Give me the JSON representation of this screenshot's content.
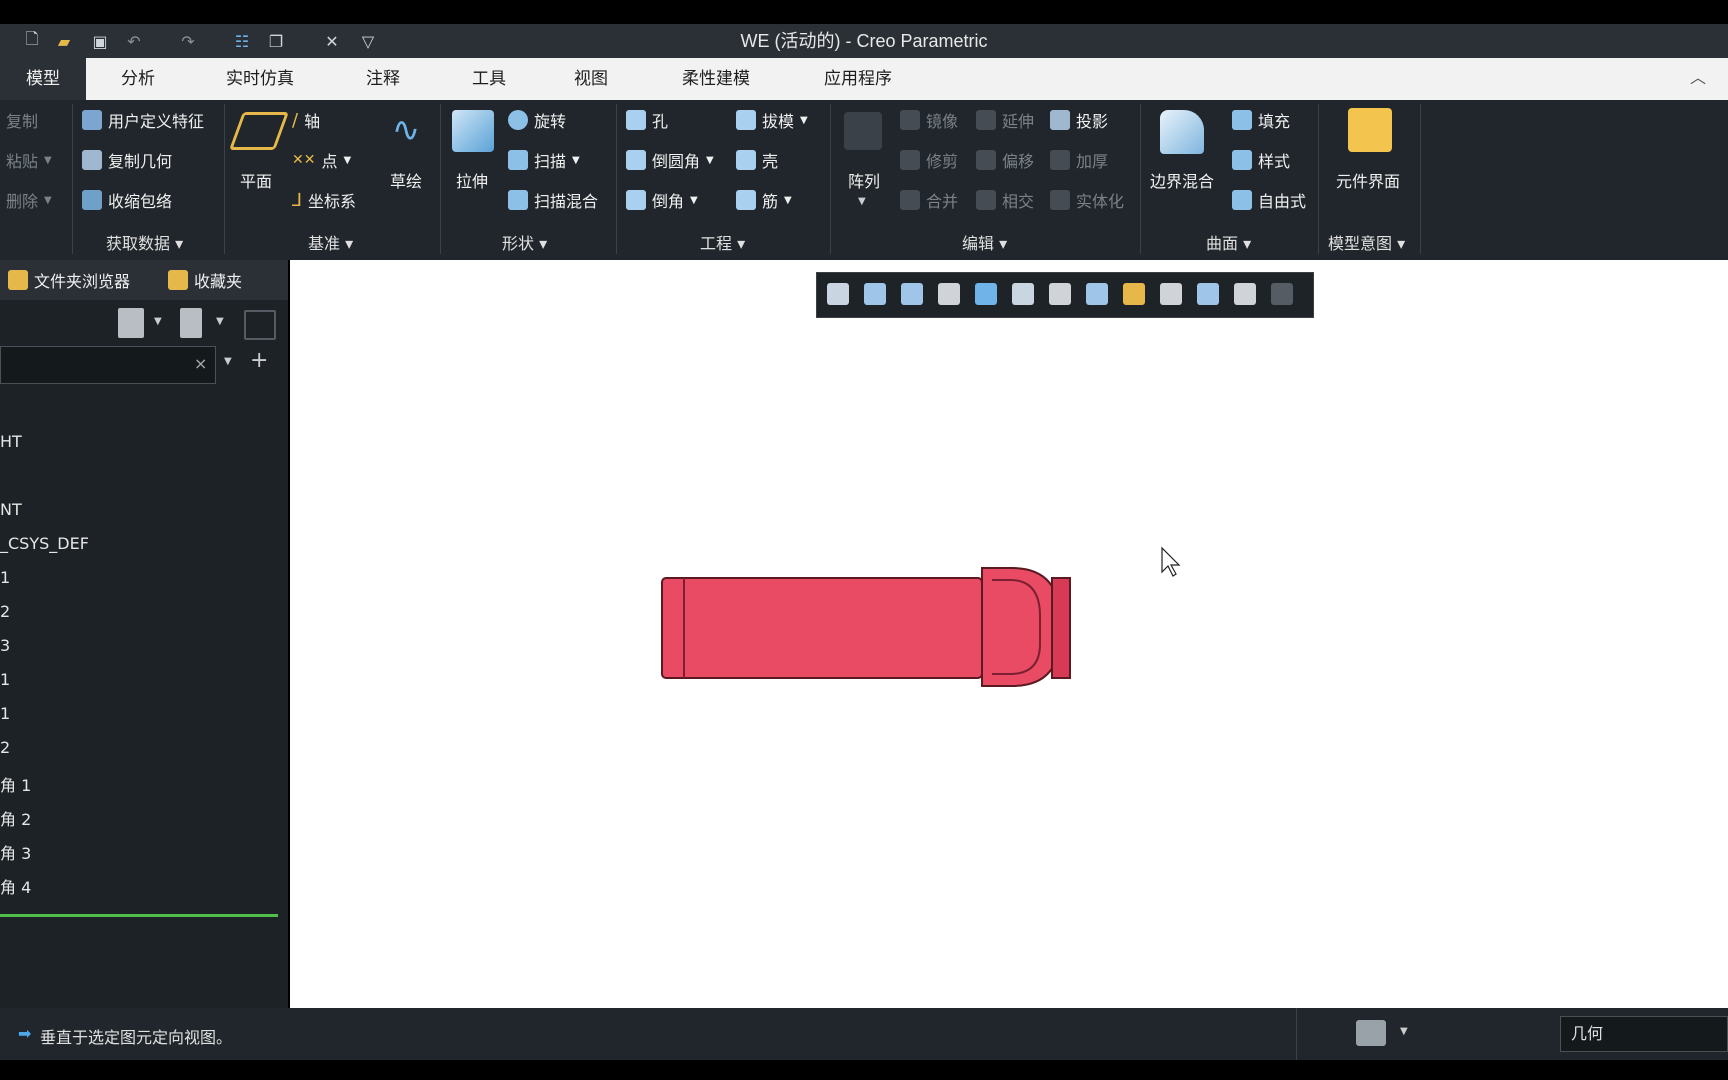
{
  "window": {
    "title": "WE (活动的) - Creo Parametric"
  },
  "quick_access": {
    "icons": [
      "new-icon",
      "open-icon",
      "save-icon",
      "undo-icon",
      "redo-icon",
      "regenerate-icon",
      "windows-icon",
      "close-icon",
      "customize-icon"
    ]
  },
  "tabs": [
    {
      "label": "模型",
      "active": true
    },
    {
      "label": "分析",
      "active": false
    },
    {
      "label": "实时仿真",
      "active": false
    },
    {
      "label": "注释",
      "active": false
    },
    {
      "label": "工具",
      "active": false
    },
    {
      "label": "视图",
      "active": false
    },
    {
      "label": "柔性建模",
      "active": false
    },
    {
      "label": "应用程序",
      "active": false
    }
  ],
  "ribbon": {
    "operations": {
      "copy": "复制",
      "paste": "粘贴",
      "delete": "删除"
    },
    "get_data": {
      "label": "获取数据",
      "udf": "用户定义特征",
      "copy_geom": "复制几何",
      "shrinkwrap": "收缩包络"
    },
    "datum": {
      "label": "基准",
      "plane": "平面",
      "axis": "轴",
      "point": "点",
      "csys": "坐标系",
      "sketch": "草绘"
    },
    "shapes": {
      "label": "形状",
      "extrude": "拉伸",
      "revolve": "旋转",
      "sweep": "扫描",
      "swept_blend": "扫描混合"
    },
    "engineering": {
      "label": "工程",
      "hole": "孔",
      "round": "倒圆角",
      "chamfer": "倒角",
      "draft": "拔模",
      "shell": "壳",
      "rib": "筋"
    },
    "editing": {
      "label": "编辑",
      "pattern": "阵列",
      "mirror": "镜像",
      "trim": "修剪",
      "merge": "合并",
      "extend": "延伸",
      "offset": "偏移",
      "intersect": "相交",
      "project": "投影",
      "thicken": "加厚",
      "solidify": "实体化"
    },
    "surfaces": {
      "label": "曲面",
      "boundary_blend": "边界混合",
      "fill": "填充",
      "style": "样式",
      "freestyle": "自由式"
    },
    "model_intent": {
      "label": "模型意图",
      "component_interface": "元件界面"
    }
  },
  "panel": {
    "folder_browser": "文件夹浏览器",
    "favorites": "收藏夹",
    "tree_items": [
      "HT",
      "NT",
      "_CSYS_DEF",
      "1",
      "2",
      "3",
      "1",
      "1",
      "2",
      "角 1",
      "角 2",
      "角 3",
      "角 4"
    ]
  },
  "status": {
    "message": "垂直于选定图元定向视图。",
    "filter_value": "几何"
  },
  "colors": {
    "accent": "#1e8ad6",
    "model": "#e94a64",
    "ribbon_bg": "#20262b",
    "tab_active_bg": "#2a3036"
  }
}
